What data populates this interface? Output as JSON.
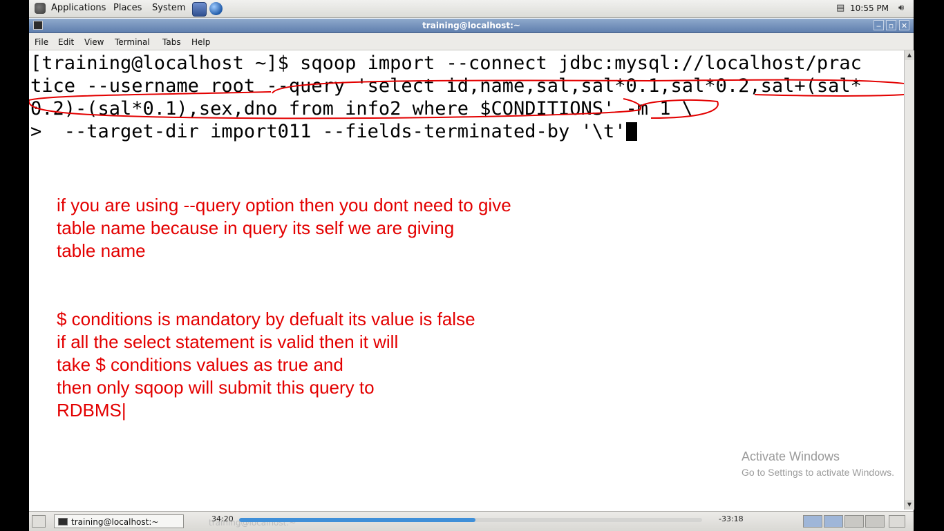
{
  "top_panel": {
    "menus": [
      "Applications",
      "Places",
      "System"
    ],
    "clock": "10:55 PM"
  },
  "window": {
    "title": "training@localhost:~",
    "buttons": [
      "‒",
      "▫",
      "✕"
    ]
  },
  "menubar": [
    "File",
    "Edit",
    "View",
    "Terminal",
    "Tabs",
    "Help"
  ],
  "terminal": {
    "lines": [
      "[training@localhost ~]$ sqoop import --connect jdbc:mysql://localhost/prac",
      "tice --username root --query 'select id,name,sal,sal*0.1,sal*0.2,sal+(sal*",
      "0.2)-(sal*0.1),sex,dno from info2 where $CONDITIONS' -m 1 \\",
      ">  --target-dir import011 --fields-terminated-by '\\t'"
    ]
  },
  "annotations": {
    "note1": [
      "if you are using --query option then you dont need to give",
      "table name because in query its self we are giving",
      "table name"
    ],
    "note2": [
      "$ conditions is mandatory by defualt its value is false",
      "if all the select statement is valid then it will",
      "take $ conditions values as true and",
      "then only sqoop will submit this query to",
      "RDBMS|"
    ]
  },
  "watermark": {
    "title": "Activate Windows",
    "subtitle": "Go to Settings to activate Windows."
  },
  "taskbar": {
    "task_label": "training@localhost:~",
    "ghost_label": "training@localhost:~",
    "elapsed": "34:20",
    "remaining": "-33:18",
    "progress_percent": 51
  },
  "colors": {
    "annotation": "#e30000",
    "titlebar": "#6f8dbb",
    "progress": "#3f8fd8"
  }
}
